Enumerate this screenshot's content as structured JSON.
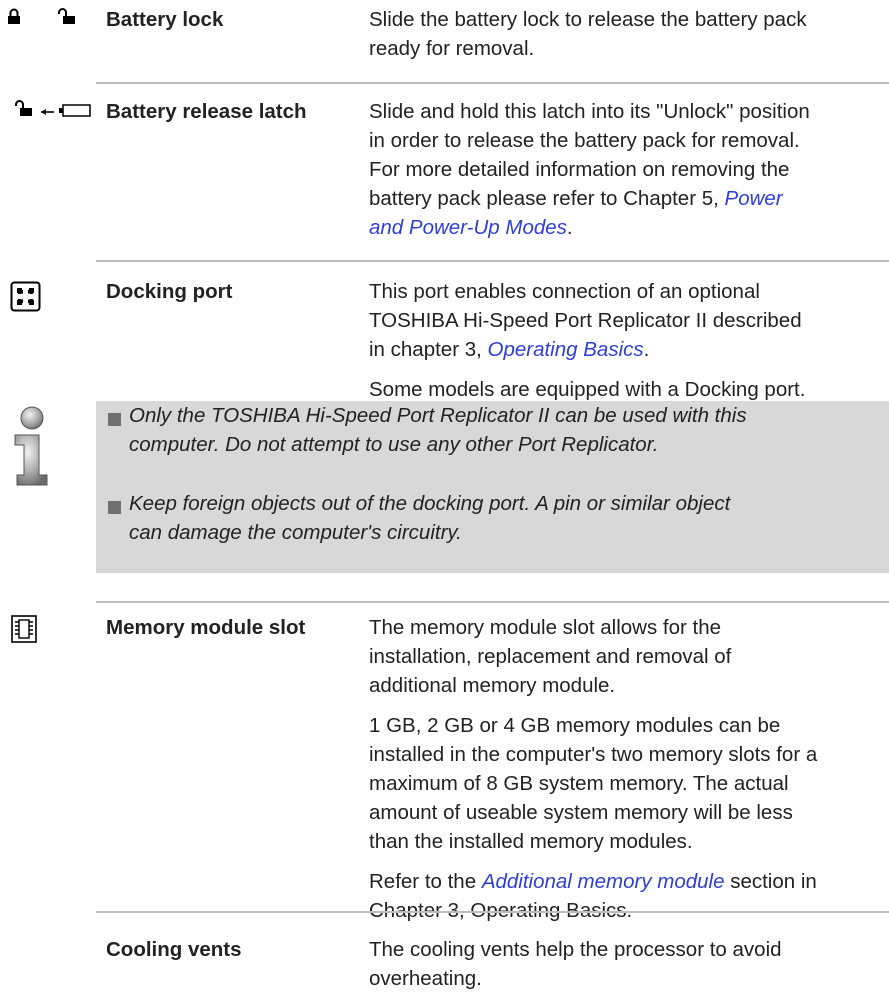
{
  "rows": [
    {
      "term": "Battery lock",
      "desc_1": "Slide the battery lock to release the battery pack",
      "desc_2": "ready for removal."
    },
    {
      "term": "Battery release latch",
      "desc_1": "Slide and hold this latch into its \"Unlock\" position",
      "desc_2": "in order to release the battery pack for removal.",
      "desc_3": "For more detailed information on removing the",
      "desc_4_prefix": "battery pack please refer to Chapter 5, ",
      "link_part1": "Power",
      "link_part2": "and Power-Up Modes",
      "desc_5_suffix": "."
    },
    {
      "term": "Docking port",
      "p1_line1": "This port enables connection of an optional",
      "p1_line2": "TOSHIBA Hi-Speed Port Replicator II described",
      "p1_line3_prefix": "in chapter 3, ",
      "p1_link": "Operating Basics",
      "p1_line3_suffix": ".",
      "p2": "Some models are equipped with a Docking port."
    },
    {
      "term": "Memory module slot",
      "p1_line1": "The memory module slot allows for the",
      "p1_line2": "installation, replacement and removal of",
      "p1_line3": "additional memory module.",
      "p2_line1": "1 GB, 2 GB or 4 GB memory modules can be",
      "p2_line2": "installed in the computer's two memory slots for a",
      "p2_line3": "maximum of 8 GB system memory. The actual",
      "p2_line4": "amount of useable system memory will be less",
      "p2_line5": "than the installed memory modules.",
      "p3_prefix": "Refer to the ",
      "p3_link": "Additional memory module",
      "p3_suffix": " section in",
      "p3_line2": "Chapter 3, Operating Basics."
    },
    {
      "term": "Cooling vents",
      "desc_1": "The cooling vents help the processor to avoid",
      "desc_2": "overheating."
    }
  ],
  "note": {
    "icon": "info-icon",
    "items": [
      {
        "line1": "Only the TOSHIBA Hi-Speed Port Replicator II can be used with this",
        "line2": "computer. Do not attempt to use any other Port Replicator."
      },
      {
        "line1": "Keep foreign objects out of the docking port. A pin or similar object",
        "line2": "can damage the computer's circuitry."
      }
    ]
  },
  "icons": {
    "battery_lock": [
      "lock-closed-icon",
      "lock-open-icon"
    ],
    "battery_release": [
      "lock-open-icon",
      "arrow-left-icon",
      "battery-icon"
    ],
    "docking_port": "docking-port-icon",
    "memory_slot": "memory-chip-icon"
  },
  "colors": {
    "link": "#2e3fd3",
    "note_background": "#d8d8d8",
    "rule": "#bdbdbd"
  }
}
